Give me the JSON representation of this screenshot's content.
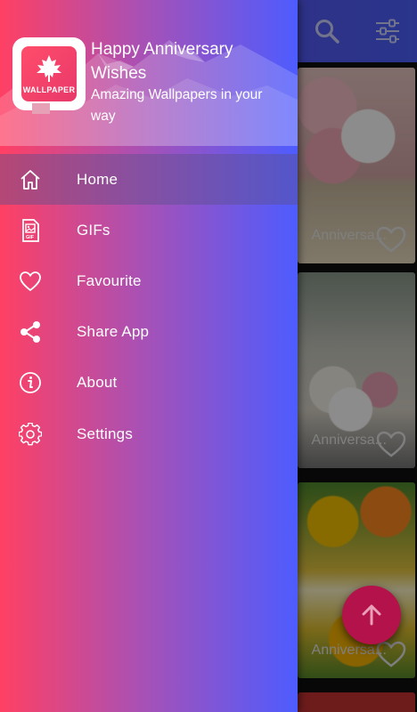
{
  "header": {
    "title": "Happy Anniversary Wishes",
    "subtitle": "Amazing Wallpapers in your way",
    "logo_text": "WALLPAPER"
  },
  "menu": {
    "items": [
      {
        "label": "Home",
        "icon": "home-icon",
        "active": true
      },
      {
        "label": "GIFs",
        "icon": "gif-icon",
        "active": false
      },
      {
        "label": "Favourite",
        "icon": "heart-outline-icon",
        "active": false
      },
      {
        "label": "Share App",
        "icon": "share-icon",
        "active": false
      },
      {
        "label": "About",
        "icon": "info-icon",
        "active": false
      },
      {
        "label": "Settings",
        "icon": "gear-icon",
        "active": false
      }
    ]
  },
  "toolbar": {
    "search_icon": "search-icon",
    "filter_icon": "sliders-icon"
  },
  "feed": {
    "cards": [
      {
        "caption": "Anniversa..."
      },
      {
        "caption": "Anniversa..."
      },
      {
        "caption": "Anniversa..."
      }
    ]
  },
  "fab": {
    "icon": "arrow-up-icon"
  },
  "colors": {
    "drawer_left": "#ff4063",
    "drawer_mid": "#ad50b1",
    "drawer_right": "#4d5cff",
    "fab": "#b3124a"
  }
}
